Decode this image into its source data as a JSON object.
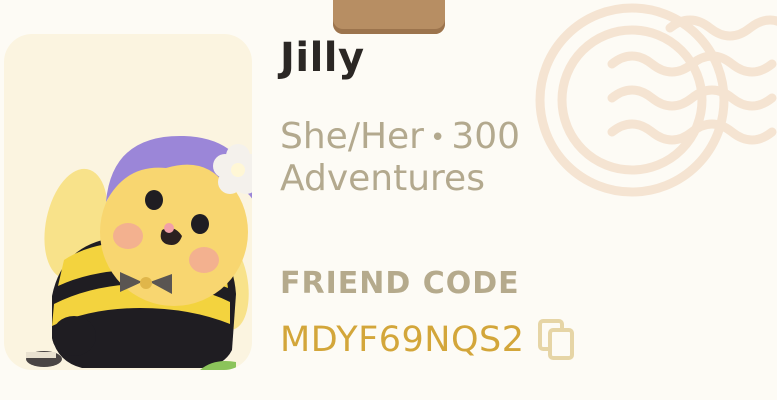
{
  "profile": {
    "name": "Jilly",
    "pronouns": "She/Her",
    "separator": "•",
    "adventures_line1": "300",
    "adventures_line2": "Adventures"
  },
  "friend_code": {
    "label": "FRIEND CODE",
    "value": "MDYF69NQS2"
  },
  "icons": {
    "copy": "copy-icon",
    "stamp": "postmark-stamp-icon",
    "avatar": "bee-avatar"
  },
  "colors": {
    "background": "#fdfbf5",
    "name": "#2b2724",
    "muted": "#b3a98e",
    "accent": "#d3a63a",
    "tab": "#b78e63"
  }
}
